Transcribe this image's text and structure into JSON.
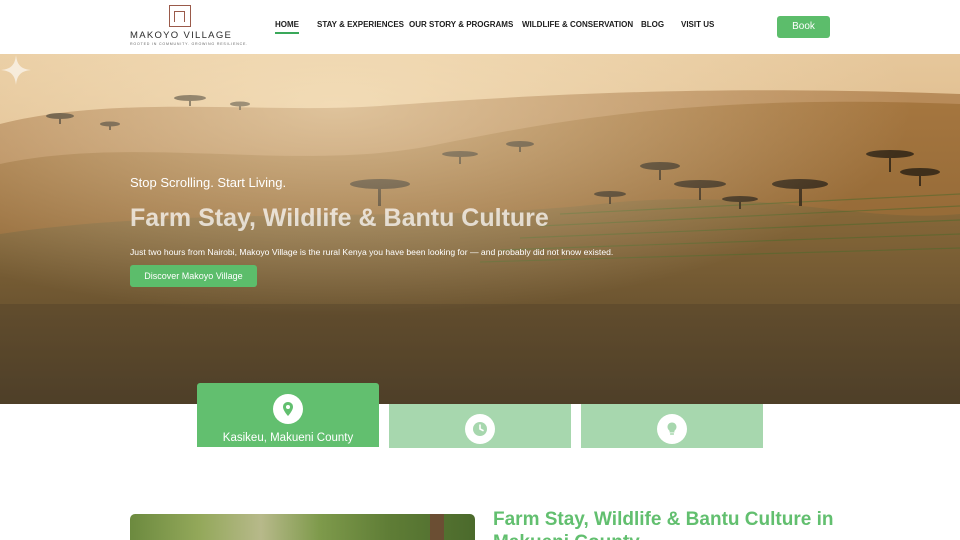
{
  "brand": {
    "name": "MAKOYO VILLAGE",
    "tagline": "Rooted in community. Growing resilience."
  },
  "nav": {
    "items": [
      "HOME",
      "STAY & EXPERIENCES",
      "OUR STORY & PROGRAMS",
      "WILDLIFE & CONSERVATION",
      "BLOG",
      "VISIT US"
    ],
    "active": "HOME",
    "book_label": "Book"
  },
  "hero": {
    "tagline": "Stop Scrolling. Start Living.",
    "title": "Farm Stay, Wildlife & Bantu Culture",
    "description": "Just two hours from Nairobi, Makoyo Village is the rural Kenya you have been looking for — and probably did not know existed.",
    "cta_label": "Discover Makoyo Village"
  },
  "info_cards": [
    {
      "icon": "location-pin-icon",
      "label": "Kasikeu, Makueni County",
      "active": true
    },
    {
      "icon": "clock-icon",
      "label": ""
    },
    {
      "icon": "lightbulb-icon",
      "label": ""
    }
  ],
  "intro": {
    "heading_line_1": "Farm Stay, Wildlife & Bantu Culture in",
    "heading_line_2": "Makueni County"
  },
  "colors": {
    "accent": "#5cbd6b",
    "card_inactive": "#a7d7ae",
    "text_dark": "#1d1d1d",
    "logo": "#9a5a4a"
  }
}
